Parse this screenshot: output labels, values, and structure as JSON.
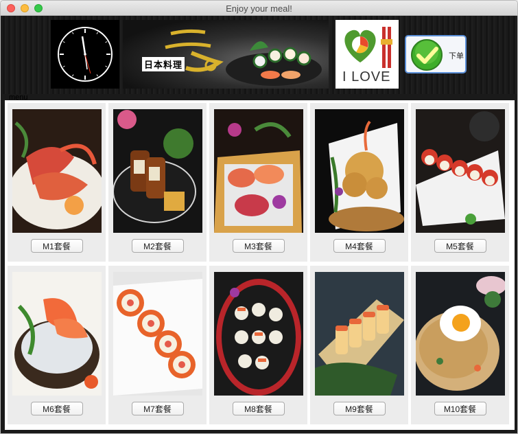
{
  "window": {
    "title": "Enjoy your meal!"
  },
  "banner": {
    "logo_text": "日本料理",
    "love_text": "I LOVE",
    "order_button_label": "下单"
  },
  "menu": {
    "legend": "menu",
    "items": [
      {
        "label": "M1套餐"
      },
      {
        "label": "M2套餐"
      },
      {
        "label": "M3套餐"
      },
      {
        "label": "M4套餐"
      },
      {
        "label": "M5套餐"
      },
      {
        "label": "M6套餐"
      },
      {
        "label": "M7套餐"
      },
      {
        "label": "M8套餐"
      },
      {
        "label": "M9套餐"
      },
      {
        "label": "M10套餐"
      }
    ]
  },
  "colors": {
    "close": "#fc605b",
    "minimize": "#fdbc40",
    "maximize": "#34c84a",
    "order_check": "#3fae2a",
    "banner_bg": "#1a1a1a"
  },
  "icons": {
    "clock": "analog-clock-icon",
    "order": "checkmark-icon"
  }
}
